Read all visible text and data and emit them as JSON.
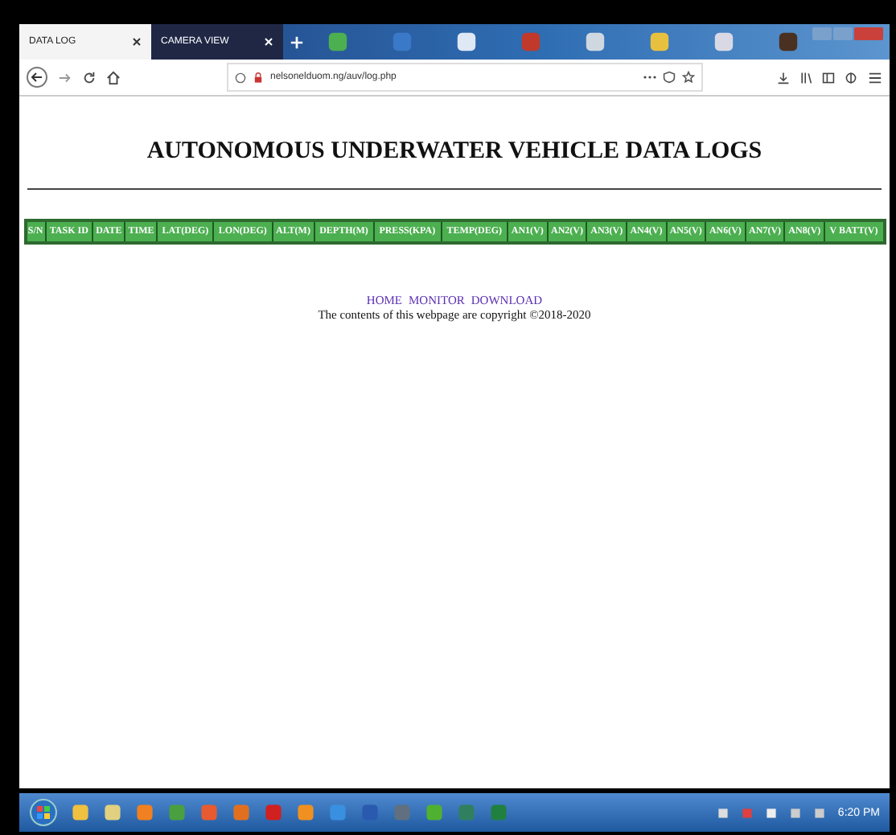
{
  "browser": {
    "tabs": [
      {
        "label": "DATA LOG",
        "selected": true
      },
      {
        "label": "CAMERA VIEW",
        "selected": false
      }
    ],
    "url": "nelsonelduom.ng/auv/log.php"
  },
  "page": {
    "title": "AUTONOMOUS UNDERWATER VEHICLE DATA LOGS",
    "table": {
      "columns": [
        "S/N",
        "TASK ID",
        "DATE",
        "TIME",
        "LAT(DEG)",
        "LON(DEG)",
        "ALT(M)",
        "DEPTH(M)",
        "PRESS(KPA)",
        "TEMP(DEG)",
        "AN1(V)",
        "AN2(V)",
        "AN3(V)",
        "AN4(V)",
        "AN5(V)",
        "AN6(V)",
        "AN7(V)",
        "AN8(V)",
        "V BATT(V)"
      ]
    },
    "links": [
      "HOME",
      "MONITOR",
      "DOWNLOAD"
    ],
    "copyright": "The contents of this webpage are copyright ©2018-2020"
  },
  "taskbar": {
    "clock": "6:20 PM"
  }
}
